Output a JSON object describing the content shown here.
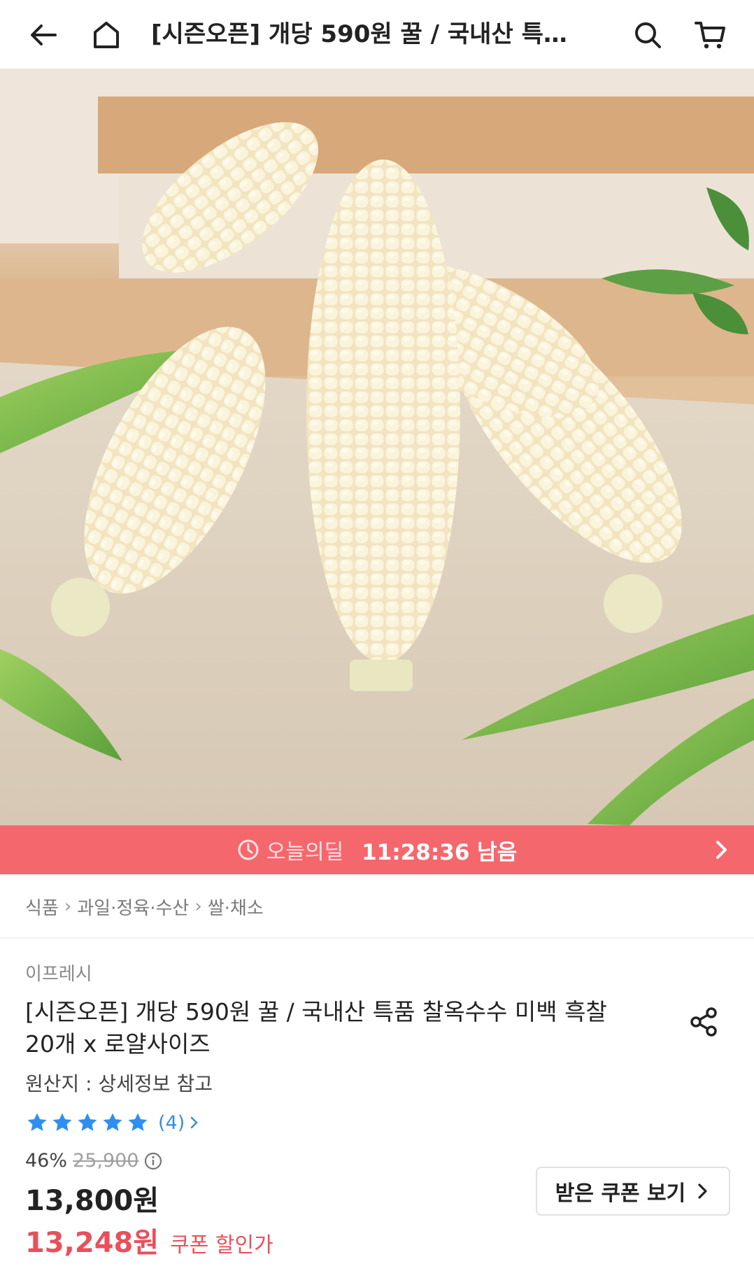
{
  "header": {
    "title": "[시즌오픈] 개당 590원 꿀 / 국내산 특품 ⋯"
  },
  "deal": {
    "label": "오늘의딜",
    "time_left": "11:28:36 남음"
  },
  "breadcrumb": [
    "식품",
    "과일·정육·수산",
    "쌀·채소"
  ],
  "product": {
    "seller": "이프레시",
    "title_line1": "[시즌오픈] 개당 590원 꿀 / 국내산 특품 찰옥수수 미백 흑찰",
    "title_line2": "20개 x 로얄사이즈",
    "origin": "원산지 : 상세정보 참고",
    "rating": 5,
    "review_count": "(4)",
    "discount": "46%",
    "original_price": "25,900",
    "price": "13,800원",
    "coupon_price": "13,248원",
    "coupon_label": "쿠폰 할인가",
    "coupon_button": "받은 쿠폰 보기"
  },
  "colors": {
    "deal_bar": "#f4686d",
    "coupon_price": "#e8505b",
    "star": "#2f8ff0"
  },
  "icons": [
    "back-arrow-icon",
    "home-icon",
    "search-icon",
    "cart-icon",
    "clock-icon",
    "chevron-right-icon",
    "share-icon",
    "star-icon",
    "info-icon"
  ]
}
